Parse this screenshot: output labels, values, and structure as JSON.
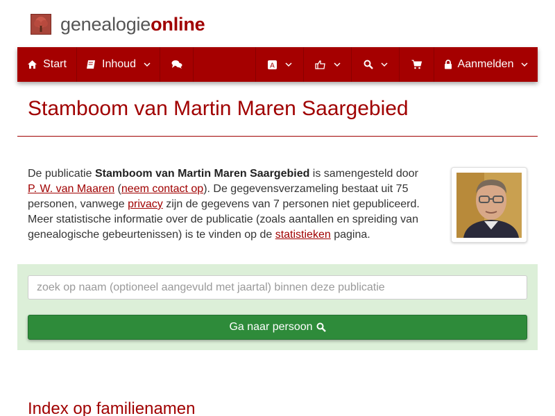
{
  "brand": {
    "name_part1": "genealogie",
    "name_part2": "online",
    "accent": "#a00000"
  },
  "nav": {
    "start_label": "Start",
    "inhoud_label": "Inhoud",
    "login_label": "Aanmelden",
    "icons": [
      "home-icon",
      "book-icon",
      "comments-icon",
      "language-icon",
      "thumbs-up-icon",
      "search-icon",
      "cart-icon",
      "lock-icon"
    ],
    "background": "#a50000"
  },
  "page": {
    "title": "Stamboom van Martin Maren Saargebied"
  },
  "intro": {
    "t1": "De publicatie ",
    "pub_name": "Stamboom van Martin Maren Saargebied",
    "t2": " is samengesteld door ",
    "author_link": "P. W. van Maaren",
    "t3": " (",
    "contact_link": "neem contact op",
    "t4": "). De gegevensverzameling bestaat uit 75 personen, vanwege ",
    "privacy_link": "privacy",
    "t5": " zijn de gegevens van 7 personen niet gepubliceerd. Meer statistische informatie over de publicatie (zoals aantallen en spreiding van genealogische gebeurtenissen) is te vinden op de ",
    "stats_link": "statistieken",
    "t6": " pagina."
  },
  "search": {
    "placeholder": "zoek op naam (optioneel aangevuld met jaartal) binnen deze publicatie",
    "button_label": "Ga naar persoon",
    "panel_color": "#dcefd8",
    "button_color": "#2e8b3a"
  },
  "index": {
    "heading": "Index op familienamen"
  }
}
